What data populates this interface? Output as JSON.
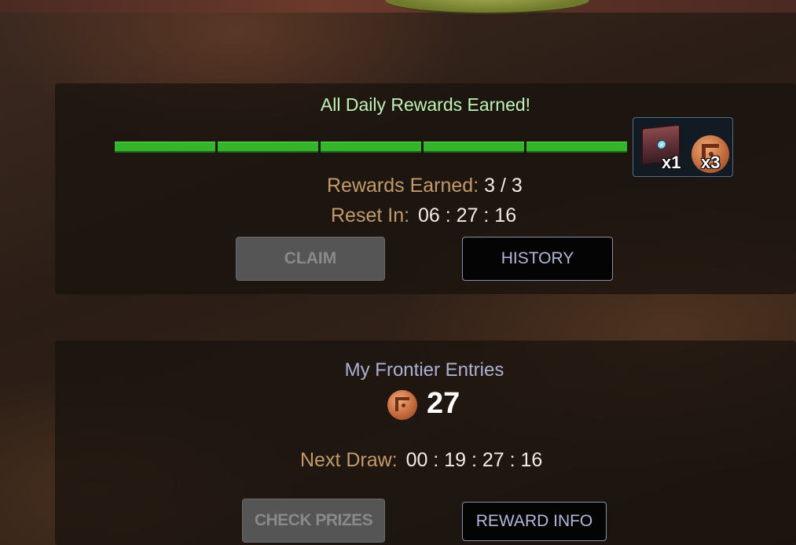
{
  "daily": {
    "status_title": "All Daily Rewards Earned!",
    "progress_segments_filled": 5,
    "progress_segments_total": 5,
    "reward_chest_qty": "x1",
    "reward_coin_qty": "x3",
    "rewards_label": "Rewards Earned:",
    "rewards_value": "3 / 3",
    "reset_label": "Reset In:",
    "reset_value": "06 : 27 : 16",
    "claim_label": "CLAIM",
    "history_label": "HISTORY"
  },
  "frontier": {
    "title": "My Frontier Entries",
    "entries_count": "27",
    "next_draw_label": "Next Draw:",
    "next_draw_value": "00 : 19 : 27 : 16",
    "check_prizes_label": "CHECK PRIZES",
    "reward_info_label": "REWARD INFO"
  },
  "icons": [
    "reward-chest-icon",
    "frontier-coin-icon"
  ],
  "colors": {
    "status_green": "#bff2b4",
    "progress_green": "#34b52c",
    "label_tan": "#c59a6a",
    "title_lavender": "#aab1d4"
  }
}
